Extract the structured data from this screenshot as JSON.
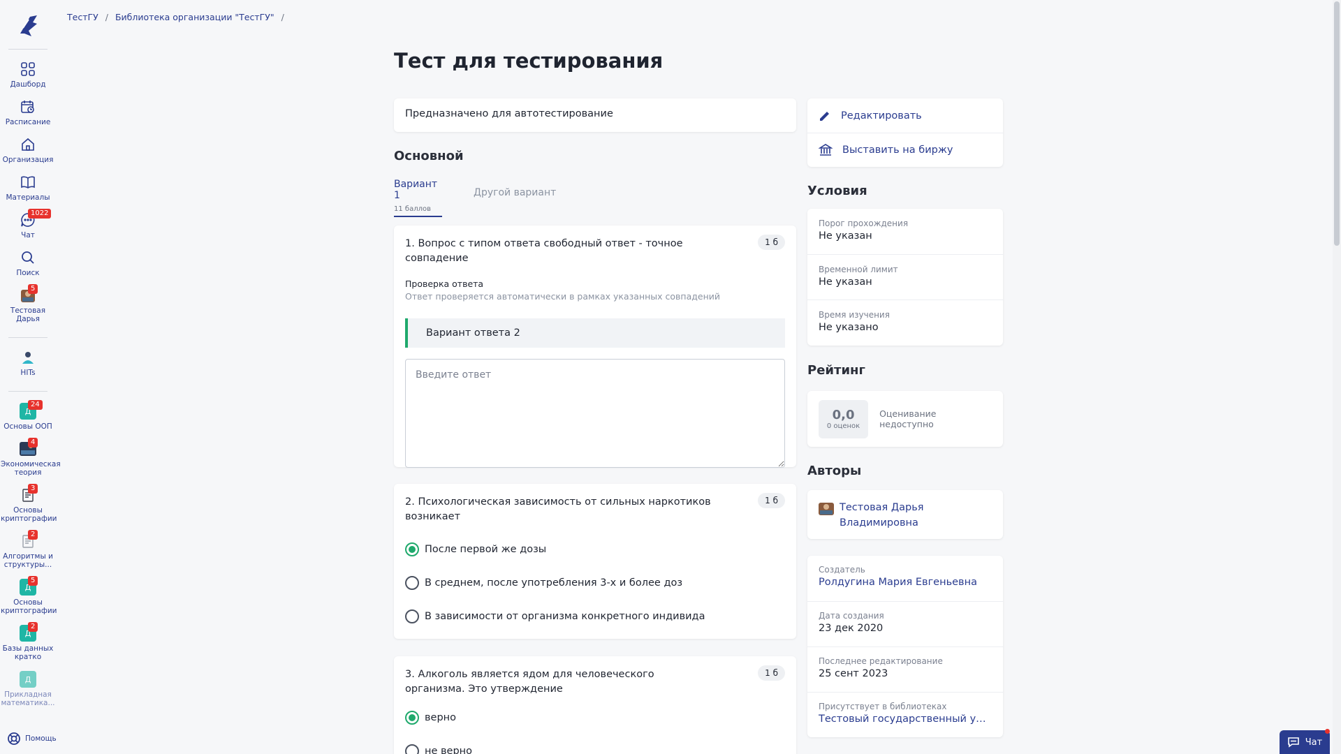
{
  "breadcrumb": [
    {
      "label": "ТестГУ"
    },
    {
      "label": "Библиотека организации \"ТестГУ\""
    }
  ],
  "sidebar": {
    "items": [
      {
        "label": "Дашборд",
        "icon": "grid-icon"
      },
      {
        "label": "Расписание",
        "icon": "calendar-clock-icon"
      },
      {
        "label": "Организация",
        "icon": "home-icon"
      },
      {
        "label": "Материалы",
        "icon": "book-icon"
      },
      {
        "label": "Чат",
        "icon": "chat-icon",
        "badge": "1022"
      },
      {
        "label": "Поиск",
        "icon": "search-icon"
      },
      {
        "label": "Тестовая Дарья",
        "icon": "user-avatar-icon",
        "badge": "5"
      },
      {
        "label": "HITs",
        "icon": "hits-logo-icon"
      },
      {
        "label": "Основы ООП",
        "avatar": "Д",
        "badge": "24"
      },
      {
        "label": "Экономическая теория",
        "icon": "course-image-icon",
        "badge": "4"
      },
      {
        "label": "Основы криптографии",
        "icon": "document-icon",
        "badge": "3"
      },
      {
        "label": "Алгоритмы и структуры...",
        "icon": "document-icon",
        "badge": "2"
      },
      {
        "label": "Основы криптографии",
        "avatar": "Д",
        "badge": "5"
      },
      {
        "label": "Базы данных кратко",
        "avatar": "Д",
        "badge": "2"
      },
      {
        "label": "Прикладная математика...",
        "avatar": "Д"
      }
    ],
    "help_label": "Помощь"
  },
  "page": {
    "title": "Тест для тестирования",
    "description": "Предназначено для автотестирование",
    "section_main": "Основной"
  },
  "tabs": [
    {
      "label": "Вариант 1",
      "sub": "11 баллов",
      "active": true
    },
    {
      "label": "Другой вариант",
      "active": false
    }
  ],
  "questions": [
    {
      "title": "1. Вопрос с типом ответа свободный ответ - точное совпадение",
      "score": "1 б",
      "check_title": "Проверка ответа",
      "check_sub": "Ответ проверяется автоматически в рамках указанных совпадений",
      "variant": "Вариант ответа 2",
      "input_placeholder": "Введите ответ"
    },
    {
      "title": "2. Психологическая зависимость от сильных наркотиков возникает",
      "score": "1 б",
      "options": [
        {
          "label": "После первой же дозы",
          "selected": true
        },
        {
          "label": "В среднем, после употребления 3-х и более доз",
          "selected": false
        },
        {
          "label": "В зависимости от организма конкретного индивида",
          "selected": false
        }
      ]
    },
    {
      "title": "3. Алкоголь является ядом для человеческого организма. Это утверждение",
      "score": "1 б",
      "options": [
        {
          "label": "верно",
          "selected": true
        },
        {
          "label": "не верно",
          "selected": false
        }
      ]
    }
  ],
  "actions": [
    {
      "label": "Редактировать",
      "icon": "pencil-icon"
    },
    {
      "label": "Выставить на биржу",
      "icon": "bank-icon"
    }
  ],
  "conditions": {
    "title": "Условия",
    "rows": [
      {
        "key": "Порог прохождения",
        "value": "Не указан"
      },
      {
        "key": "Временной лимит",
        "value": "Не указан"
      },
      {
        "key": "Время изучения",
        "value": "Не указано"
      }
    ]
  },
  "rating": {
    "title": "Рейтинг",
    "value": "0,0",
    "count": "0 оценок",
    "note": "Оценивание недоступно"
  },
  "authors": {
    "title": "Авторы",
    "name": "Тестовая Дарья Владимировна"
  },
  "meta": [
    {
      "key": "Создатель",
      "value": "Ролдугина Мария Евгеньевна",
      "link": true
    },
    {
      "key": "Дата создания",
      "value": "23 дек 2020",
      "link": false
    },
    {
      "key": "Последнее редактирование",
      "value": "25 сент 2023",
      "link": false
    },
    {
      "key": "Присутствует в библиотеках",
      "value": "Тестовый государственный университет",
      "link": true
    }
  ],
  "chat_button": {
    "label": "Чат"
  },
  "colors": {
    "accent": "#2a3c8f",
    "success": "#1fa96c",
    "badge": "#e7322d"
  }
}
